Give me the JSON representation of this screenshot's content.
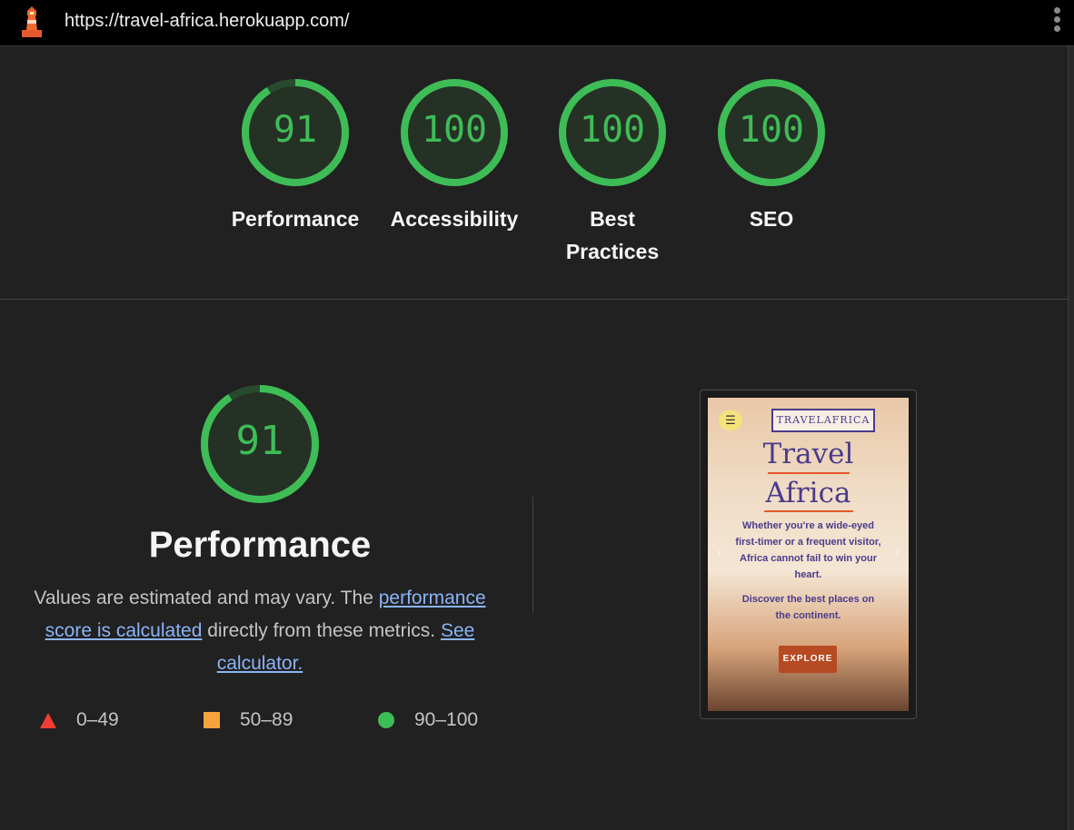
{
  "topbar": {
    "url": "https://travel-africa.herokuapp.com/",
    "logo_icon": "lighthouse-icon",
    "menu_icon": "more-vert-icon"
  },
  "summary_gauges": [
    {
      "score": "91",
      "score_value": 91,
      "label": "Performance"
    },
    {
      "score": "100",
      "score_value": 100,
      "label": "Accessibility"
    },
    {
      "score": "100",
      "score_value": 100,
      "label_line1": "Best",
      "label_line2": "Practices"
    },
    {
      "score": "100",
      "score_value": 100,
      "label": "SEO"
    }
  ],
  "performance": {
    "score": "91",
    "score_value": 91,
    "title": "Performance",
    "desc_prefix": "Values are estimated and may vary. The ",
    "desc_link1": "performance score is calculated",
    "desc_middle": " directly from these metrics. ",
    "desc_link2": "See calculator."
  },
  "legend": [
    {
      "range": "0–49",
      "shape": "triangle",
      "color": "#f23d33"
    },
    {
      "range": "50–89",
      "shape": "square",
      "color": "#f5a33b"
    },
    {
      "range": "90–100",
      "shape": "circle",
      "color": "#3ebd57"
    }
  ],
  "screenshot": {
    "brand": "TRAVELAFRICA",
    "heading1": "Travel",
    "heading2": "Africa",
    "para1": "Whether you're a wide-eyed first-timer or a frequent visitor, Africa cannot fail to win your heart.",
    "para2": "Discover the best places on the continent.",
    "button": "EXPLORE",
    "menu_icon": "hamburger-menu-icon"
  },
  "colors": {
    "pass": "#3ebd57",
    "background": "#212121",
    "link": "#8ab4f8"
  }
}
